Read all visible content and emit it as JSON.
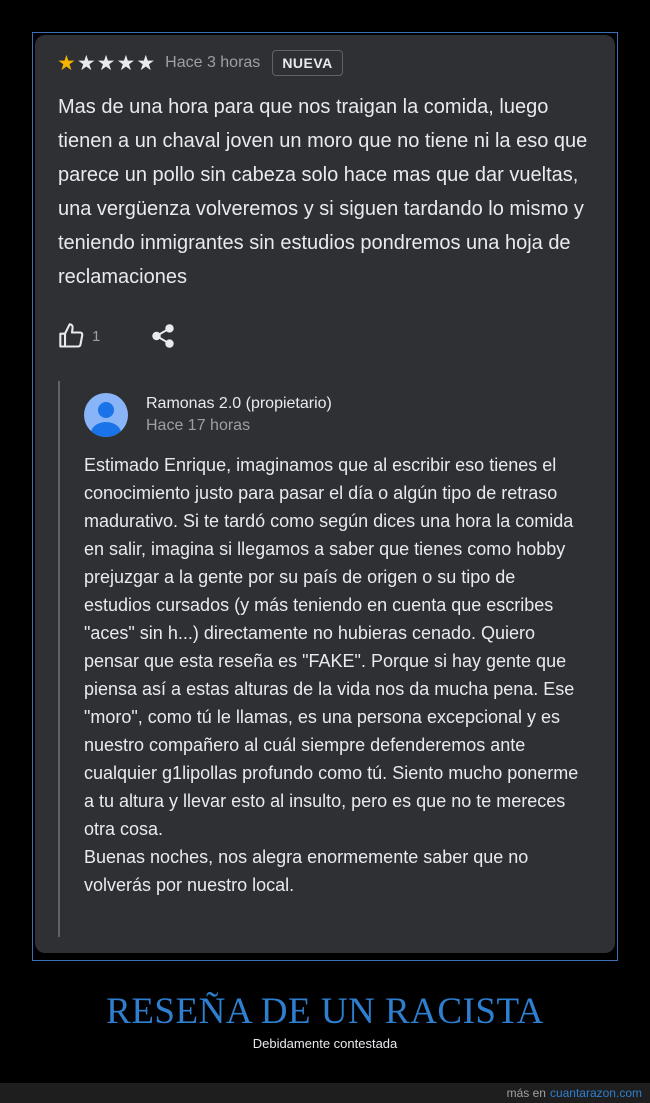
{
  "review": {
    "rating": 1,
    "max_rating": 5,
    "time": "Hace 3 horas",
    "badge": "NUEVA",
    "text": "Mas de una hora para que nos traigan la comida, luego tienen a un chaval joven un moro que no tiene ni la eso que parece un pollo sin cabeza solo hace mas que dar vueltas, una vergüenza volveremos y si siguen tardando lo mismo y teniendo inmigrantes sin estudios pondremos una hoja de reclamaciones",
    "likes": "1",
    "icons": {
      "like": "thumbs-up-icon",
      "share": "share-icon"
    }
  },
  "reply": {
    "owner_name": "Ramonas 2.0 (propietario)",
    "time": "Hace 17 horas",
    "paragraph_1": "Estimado Enrique, imaginamos que al escribir eso tienes el conocimiento justo para pasar el día o algún tipo de retraso madurativo. Si te tardó como según dices una hora la comida en salir, imagina si llegamos a saber que tienes como hobby prejuzgar a la gente por su país de origen o su tipo de estudios cursados (y más teniendo en cuenta que escribes \"aces\" sin h...) directamente no hubieras cenado. Quiero pensar que esta reseña es \"FAKE\". Porque si hay gente que piensa así a estas alturas de la vida nos da mucha pena. Ese \"moro\", como tú le llamas, es una persona excepcional y es nuestro compañero al cuál siempre defenderemos ante cualquier g1lipollas profundo como tú. Siento mucho ponerme a tu altura y llevar esto al insulto, pero es que no te mereces otra cosa.",
    "paragraph_2": "Buenas noches, nos alegra enormemente saber que no volverás por nuestro local."
  },
  "post": {
    "title": "RESEÑA DE UN RACISTA",
    "subtitle": "Debidamente contestada"
  },
  "footer": {
    "prefix": "más en",
    "site": "cuantarazon.com"
  },
  "colors": {
    "card_bg": "#2f3033",
    "star_filled": "#f5b400",
    "title_blue": "#2f7fd0",
    "avatar_blue": "#8ab4f8"
  }
}
